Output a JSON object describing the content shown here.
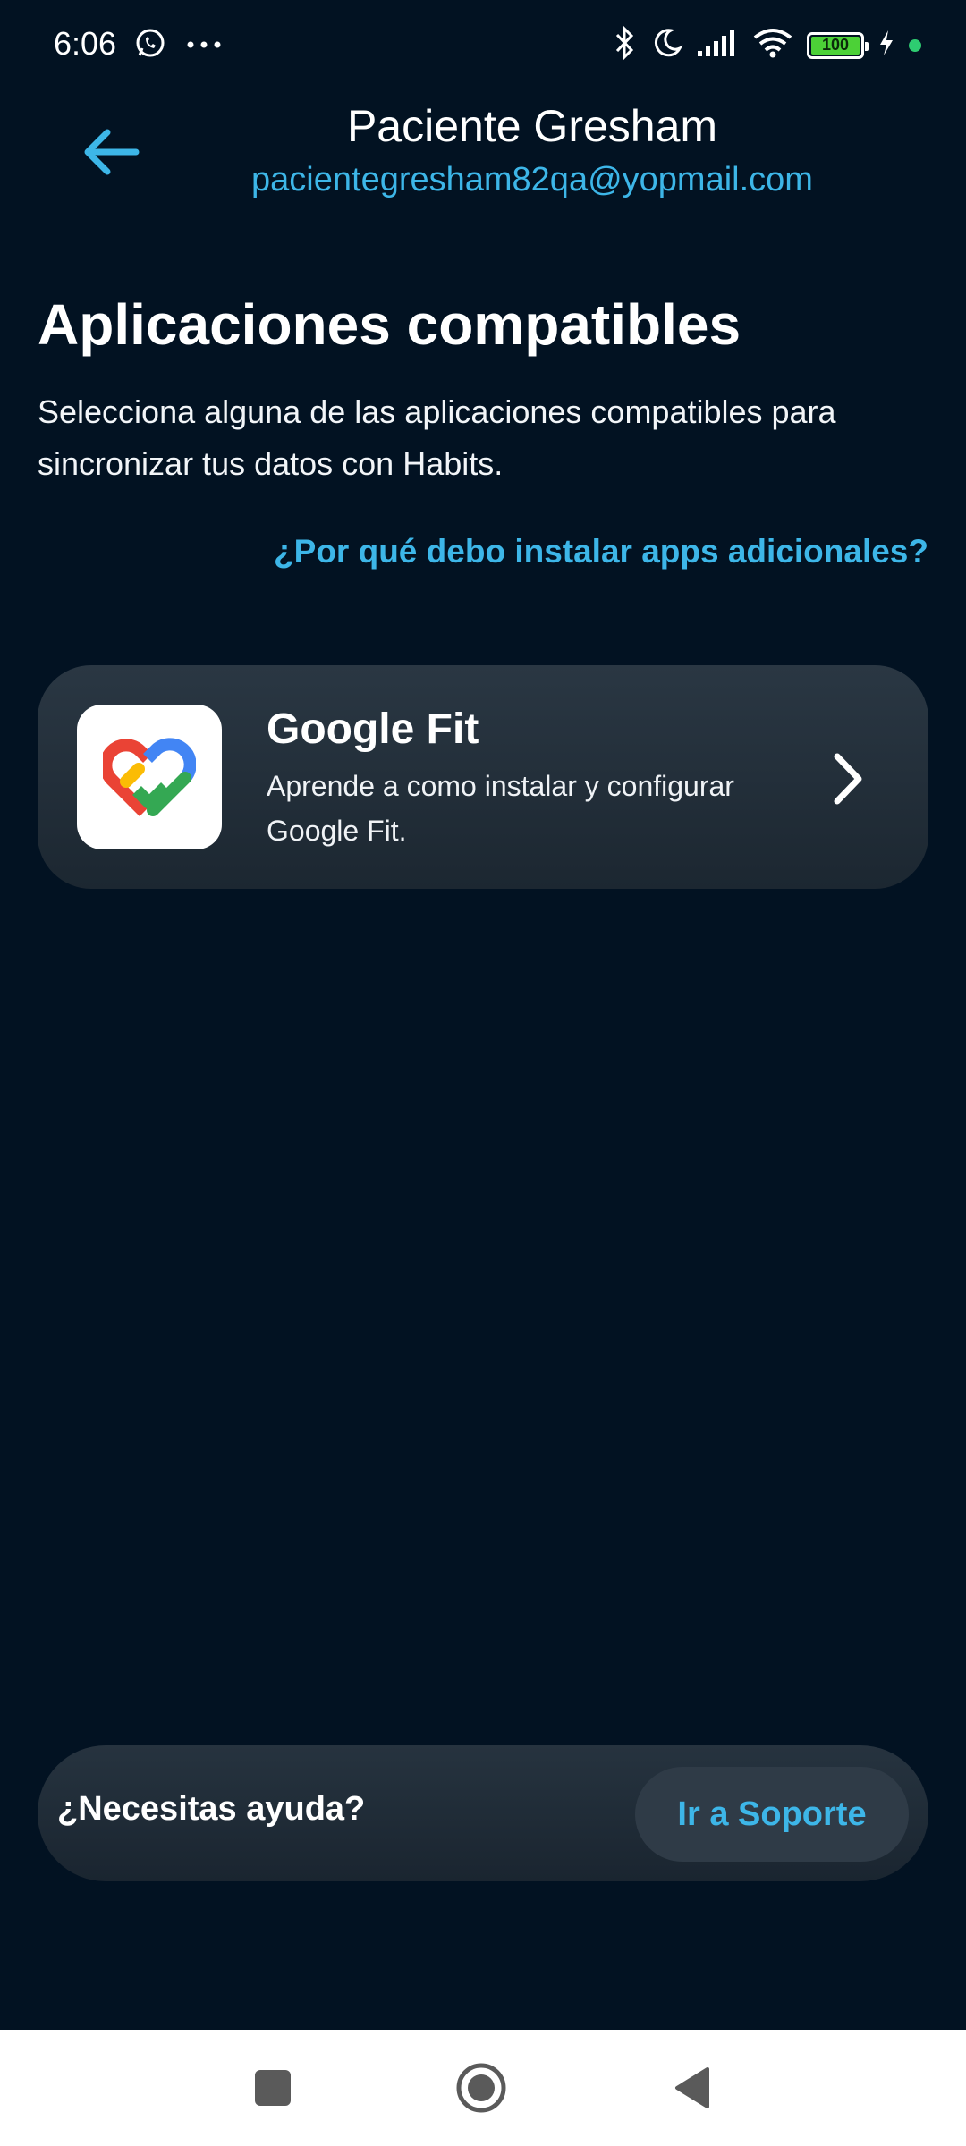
{
  "status_bar": {
    "time": "6:06",
    "battery_level": "100",
    "icons": [
      "whatsapp-icon",
      "more-dots-icon",
      "bluetooth-icon",
      "moon-icon",
      "signal-icon",
      "wifi-icon",
      "battery-icon",
      "charging-icon"
    ]
  },
  "header": {
    "title": "Paciente Gresham",
    "email": "pacientegresham82qa@yopmail.com",
    "back_icon": "arrow-left-icon"
  },
  "main": {
    "title": "Aplicaciones compatibles",
    "description": "Selecciona alguna de las aplicaciones compatibles para sincronizar tus datos con Habits.",
    "why_link": "¿Por qué debo instalar apps adicionales?",
    "apps": [
      {
        "name": "Google Fit",
        "description": "Aprende a como instalar y configurar Google Fit.",
        "icon": "google-fit-icon"
      }
    ]
  },
  "help": {
    "question": "¿Necesitas ayuda?",
    "button": "Ir a Soporte"
  },
  "colors": {
    "background": "#021222",
    "accent": "#3db6e8",
    "card": "#26333f"
  }
}
